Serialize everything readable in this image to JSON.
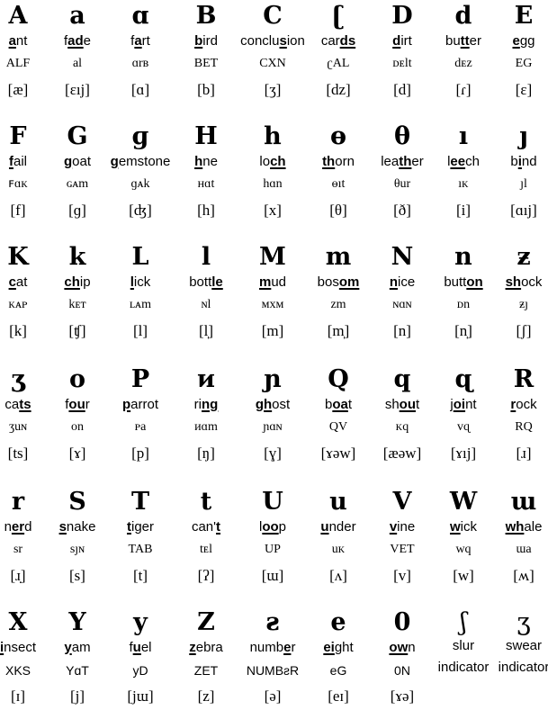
{
  "rows": [
    [
      {
        "glyph": "A",
        "word": [
          "",
          "a",
          "nt"
        ],
        "name": "ALF",
        "ipa": "[æ]"
      },
      {
        "glyph": "a",
        "word": [
          "f",
          "ad",
          "e"
        ],
        "name": "al",
        "ipa": "[ɛıj]"
      },
      {
        "glyph": "ɑ",
        "word": [
          "f",
          "a",
          "rt"
        ],
        "name": "ɑrʙ",
        "ipa": "[ɑ]"
      },
      {
        "glyph": "B",
        "word": [
          "",
          "b",
          "ird"
        ],
        "name": "BET",
        "ipa": "[b]"
      },
      {
        "glyph": "C",
        "word": [
          "conclu",
          "s",
          "ion"
        ],
        "name": "CXN",
        "ipa": "[ʒ]"
      },
      {
        "glyph": "ʗ",
        "word": [
          "car",
          "ds",
          ""
        ],
        "name": "ʗAL",
        "ipa": "[dz]"
      },
      {
        "glyph": "D",
        "word": [
          "",
          "d",
          "irt"
        ],
        "name": "ᴅᴇlt",
        "ipa": "[d]"
      },
      {
        "glyph": "d",
        "word": [
          "bu",
          "tt",
          "er"
        ],
        "name": "dᴇᴢ",
        "ipa": "[ɾ]"
      },
      {
        "glyph": "E",
        "word": [
          "",
          "e",
          "gg"
        ],
        "name": "EG",
        "ipa": "[ɛ]"
      }
    ],
    [
      {
        "glyph": "F",
        "word": [
          "",
          "f",
          "ail"
        ],
        "name": "ꜰɑᴋ",
        "ipa": "[f]"
      },
      {
        "glyph": "G",
        "word": [
          "",
          "g",
          "oat"
        ],
        "name": "ɢᴀm",
        "ipa": "[ɡ]"
      },
      {
        "glyph": "ɡ",
        "word": [
          "",
          "g",
          "emstone"
        ],
        "name": "ɡᴀk",
        "ipa": "[ʤ]"
      },
      {
        "glyph": "H",
        "word": [
          "",
          "h",
          "ne"
        ],
        "name": "ʜɑt",
        "ipa": "[h]"
      },
      {
        "glyph": "h",
        "word": [
          "lo",
          "ch",
          ""
        ],
        "name": "hɑn",
        "ipa": "[x]"
      },
      {
        "glyph": "ɵ",
        "word": [
          "",
          "th",
          "orn"
        ],
        "name": "ɵıt",
        "ipa": "[θ]"
      },
      {
        "glyph": "θ",
        "word": [
          "lea",
          "th",
          "er"
        ],
        "name": "θur",
        "ipa": "[ð]"
      },
      {
        "glyph": "ı",
        "word": [
          "l",
          "ee",
          "ch"
        ],
        "name": "ıᴋ",
        "ipa": "[i]"
      },
      {
        "glyph": "ȷ",
        "word": [
          "b",
          "i",
          "nd"
        ],
        "name": "ȷl",
        "ipa": "[ɑıj]"
      }
    ],
    [
      {
        "glyph": "K",
        "word": [
          "",
          "c",
          "at"
        ],
        "name": "ᴋᴀᴘ",
        "ipa": "[k]"
      },
      {
        "glyph": "k",
        "word": [
          "",
          "ch",
          "ip"
        ],
        "name": "kᴇᴛ",
        "ipa": "[ʧ]"
      },
      {
        "glyph": "L",
        "word": [
          "",
          "l",
          "ick"
        ],
        "name": "ʟᴀm",
        "ipa": "[l]"
      },
      {
        "glyph": "l",
        "word": [
          "bott",
          "le",
          ""
        ],
        "name": "ɴl",
        "ipa": "[l̩]"
      },
      {
        "glyph": "M",
        "word": [
          "",
          "m",
          "ud"
        ],
        "name": "ᴍxᴍ",
        "ipa": "[m]"
      },
      {
        "glyph": "m",
        "word": [
          "bos",
          "om",
          ""
        ],
        "name": "ᴢm",
        "ipa": "[m̩]"
      },
      {
        "glyph": "N",
        "word": [
          "",
          "n",
          "ice"
        ],
        "name": "ɴɑɴ",
        "ipa": "[n]"
      },
      {
        "glyph": "n",
        "word": [
          "butt",
          "on",
          ""
        ],
        "name": "ᴅn",
        "ipa": "[n̩]"
      },
      {
        "glyph": "ƶ",
        "word": [
          "",
          "sh",
          "ock"
        ],
        "name": "ƶȷ",
        "ipa": "[ʃ]"
      }
    ],
    [
      {
        "glyph": "ʒ",
        "word": [
          "ca",
          "ts",
          ""
        ],
        "name": "ʒuɴ",
        "ipa": "[ts]"
      },
      {
        "glyph": "o",
        "word": [
          "f",
          "ou",
          "r"
        ],
        "name": "on",
        "ipa": "[ɤ]"
      },
      {
        "glyph": "P",
        "word": [
          "",
          "p",
          "arrot"
        ],
        "name": "ᴘa",
        "ipa": "[p]"
      },
      {
        "glyph": "ᴎ",
        "word": [
          "ri",
          "ng",
          ""
        ],
        "name": "ᴎɑm",
        "ipa": "[ŋ]"
      },
      {
        "glyph": "ɲ",
        "word": [
          "",
          "gh",
          "ost"
        ],
        "name": "ɲɑɴ",
        "ipa": "[ɣ]"
      },
      {
        "glyph": "Q",
        "word": [
          "b",
          "oa",
          "t"
        ],
        "name": "QV",
        "ipa": "[ɤəw]"
      },
      {
        "glyph": "q",
        "word": [
          "sh",
          "ou",
          "t"
        ],
        "name": "ᴋq",
        "ipa": "[æəw]"
      },
      {
        "glyph": "ɋ",
        "word": [
          "j",
          "oi",
          "nt"
        ],
        "name": "vɋ",
        "ipa": "[ɤıj]"
      },
      {
        "glyph": "R",
        "word": [
          "",
          "r",
          "ock"
        ],
        "name": "RQ",
        "ipa": "[ɹ]"
      }
    ],
    [
      {
        "glyph": "r",
        "word": [
          "n",
          "er",
          "d"
        ],
        "name": "sr",
        "ipa": "[ɹ̣]"
      },
      {
        "glyph": "S",
        "word": [
          "",
          "s",
          "nake"
        ],
        "name": "sȷɴ",
        "ipa": "[s]"
      },
      {
        "glyph": "T",
        "word": [
          "",
          "t",
          "iger"
        ],
        "name": "TAB",
        "ipa": "[t]"
      },
      {
        "glyph": "t",
        "word": [
          "can'",
          "t",
          ""
        ],
        "name": "tᴇl",
        "ipa": "[ʔ]"
      },
      {
        "glyph": "U",
        "word": [
          "l",
          "oo",
          "p"
        ],
        "name": "UP",
        "ipa": "[ɯ]"
      },
      {
        "glyph": "u",
        "word": [
          "",
          "u",
          "nder"
        ],
        "name": "uᴋ",
        "ipa": "[ʌ]"
      },
      {
        "glyph": "V",
        "word": [
          "",
          "v",
          "ine"
        ],
        "name": "VET",
        "ipa": "[v]"
      },
      {
        "glyph": "W",
        "word": [
          "",
          "w",
          "ick"
        ],
        "name": "wq",
        "ipa": "[w]"
      },
      {
        "glyph": "ɯ",
        "word": [
          "",
          "wh",
          "ale"
        ],
        "name": "ɯa",
        "ipa": "[ʍ]"
      }
    ],
    [
      {
        "glyph": "X",
        "word": [
          "",
          "i",
          "nsect"
        ],
        "name": "XKS",
        "ipa": "[ɪ]"
      },
      {
        "glyph": "Y",
        "word": [
          "",
          "y",
          "am"
        ],
        "name": "YɑT",
        "ipa": "[j]"
      },
      {
        "glyph": "y",
        "word": [
          "f",
          "u",
          "el"
        ],
        "name": "yD",
        "ipa": "[jɯ]"
      },
      {
        "glyph": "Z",
        "word": [
          "",
          "z",
          "ebra"
        ],
        "name": "ZET",
        "ipa": "[z]"
      },
      {
        "glyph": "ƨ",
        "word": [
          "numb",
          "e",
          "r"
        ],
        "name": "NUMBƨR",
        "ipa": "[ə]"
      },
      {
        "glyph": "e",
        "word": [
          "",
          "ei",
          "ght"
        ],
        "name": "eG",
        "ipa": "[eɪ]"
      },
      {
        "glyph": "0",
        "word": [
          "",
          "ow",
          "n"
        ],
        "name": "0N",
        "ipa": "[ɤə]"
      },
      {
        "glyph": "ʃ",
        "word": [
          "slur",
          "",
          ""
        ],
        "name": "indicator",
        "ipa": ""
      },
      {
        "glyph": "ʒ",
        "word": [
          "swear",
          "",
          ""
        ],
        "name": "indicator",
        "ipa": ""
      }
    ]
  ]
}
